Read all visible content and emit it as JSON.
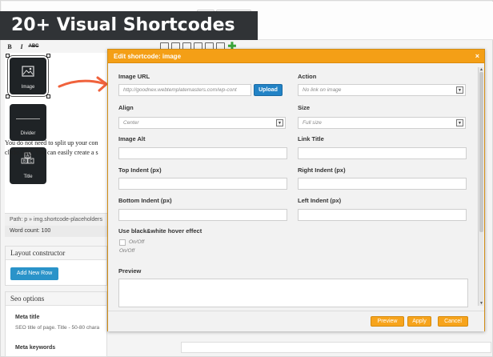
{
  "banner": {
    "title": "20+ Visual Shortcodes"
  },
  "toolbar": {
    "bold": "B",
    "italic": "I",
    "strike": "ABC"
  },
  "shortcodes": [
    {
      "label": "Image",
      "glyph": "▣"
    },
    {
      "label": "Divider",
      "glyph": ""
    },
    {
      "label": "Title",
      "glyph": "A\nB C"
    }
  ],
  "editor": {
    "body_text": "You do not need to split up your con clicks only. You can easily create a s",
    "path": "Path: p » img.shortcode-placeholders",
    "word_count": "Word count: 100"
  },
  "layout_constructor": {
    "title": "Layout constructor",
    "add_row": "Add New Row"
  },
  "seo": {
    "title": "Seo options",
    "meta_title_label": "Meta title",
    "meta_title_hint": "SEO title of page. Title - 50-80 chara",
    "meta_keywords_label": "Meta keywords"
  },
  "modal": {
    "title": "Edit shortcode: image",
    "close": "×",
    "image_url": {
      "label": "Image URL",
      "value": "http://goodnex.webtemplatemasters.com/wp-cont",
      "upload": "Upload"
    },
    "action": {
      "label": "Action",
      "value": "No link on image"
    },
    "align": {
      "label": "Align",
      "value": "Center"
    },
    "size": {
      "label": "Size",
      "value": "Full size"
    },
    "image_alt": {
      "label": "Image Alt",
      "value": ""
    },
    "link_title": {
      "label": "Link Title",
      "value": ""
    },
    "top_indent": {
      "label": "Top Indent (px)",
      "value": ""
    },
    "right_indent": {
      "label": "Right Indent (px)",
      "value": ""
    },
    "bottom_indent": {
      "label": "Bottom Indent (px)",
      "value": ""
    },
    "left_indent": {
      "label": "Left Indent (px)",
      "value": ""
    },
    "hover": {
      "label": "Use black&white hover effect",
      "toggle": "On/Off",
      "sub": "On/Off"
    },
    "preview_label": "Preview",
    "buttons": {
      "preview": "Preview",
      "apply": "Apply",
      "cancel": "Cancel"
    }
  },
  "colors": {
    "accent": "#f49f16",
    "primary_button": "#2283c6",
    "banner": "#303336"
  }
}
